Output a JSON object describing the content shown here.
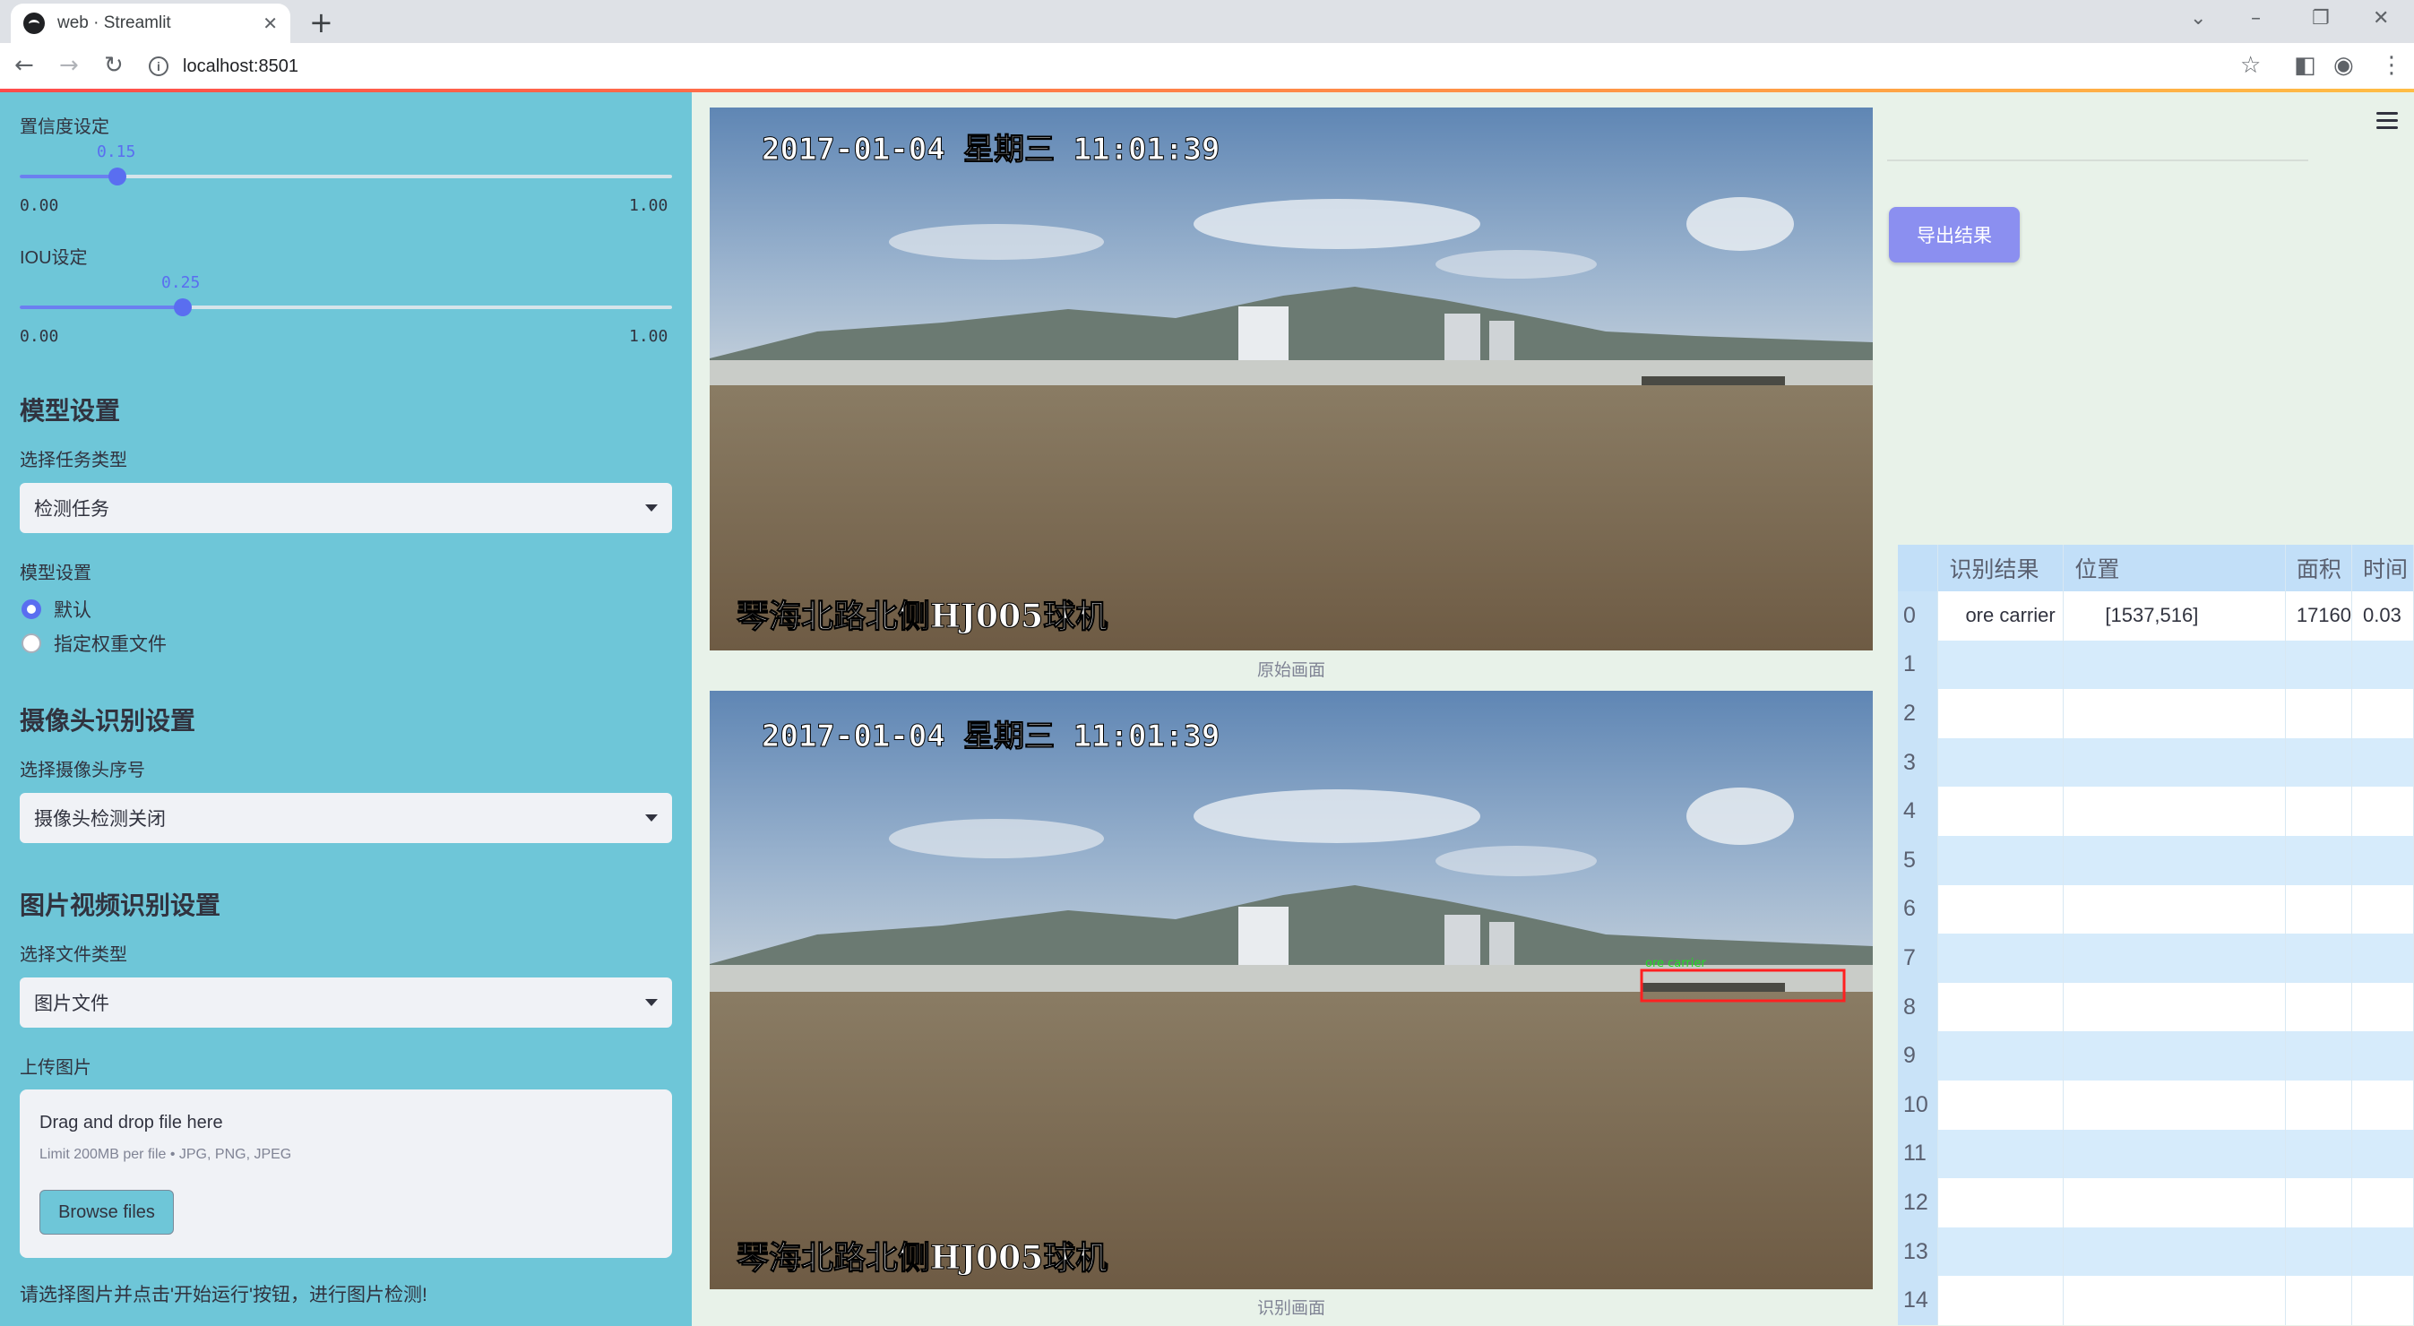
{
  "browser": {
    "tab_title": "web · Streamlit",
    "url": "localhost:8501"
  },
  "sidebar": {
    "confidence": {
      "label": "置信度设定",
      "value": "0.15",
      "min": "0.00",
      "max": "1.00",
      "fraction": 0.15
    },
    "iou": {
      "label": "IOU设定",
      "value": "0.25",
      "min": "0.00",
      "max": "1.00",
      "fraction": 0.25
    },
    "model_section": "模型设置",
    "task_label": "选择任务类型",
    "task_value": "检测任务",
    "model_label": "模型设置",
    "model_options": [
      "默认",
      "指定权重文件"
    ],
    "model_selected": "默认",
    "camera_section": "摄像头识别设置",
    "camera_label": "选择摄像头序号",
    "camera_value": "摄像头检测关闭",
    "media_section": "图片视频识别设置",
    "file_type_label": "选择文件类型",
    "file_type_value": "图片文件",
    "upload_label": "上传图片",
    "upload_title": "Drag and drop file here",
    "upload_limit": "Limit 200MB per file • JPG, PNG, JPEG",
    "browse_label": "Browse files",
    "hint": "请选择图片并点击'开始运行'按钮，进行图片检测!"
  },
  "main": {
    "frame_timestamp": "2017-01-04  星期三  11:01:39",
    "frame_overlay": "琴海北路北侧HJ005球机",
    "original_caption": "原始画面",
    "result_caption": "识别画面",
    "export_label": "导出结果",
    "detection_box_label": "ore carrier"
  },
  "table": {
    "columns": [
      "",
      "识别结果",
      "位置",
      "面积",
      "时间"
    ],
    "rows": [
      [
        "0",
        "ore carrier",
        "[1537,516]",
        "17160",
        "0.03"
      ],
      [
        "1",
        "",
        "",
        "",
        ""
      ],
      [
        "2",
        "",
        "",
        "",
        ""
      ],
      [
        "3",
        "",
        "",
        "",
        ""
      ],
      [
        "4",
        "",
        "",
        "",
        ""
      ],
      [
        "5",
        "",
        "",
        "",
        ""
      ],
      [
        "6",
        "",
        "",
        "",
        ""
      ],
      [
        "7",
        "",
        "",
        "",
        ""
      ],
      [
        "8",
        "",
        "",
        "",
        ""
      ],
      [
        "9",
        "",
        "",
        "",
        ""
      ],
      [
        "10",
        "",
        "",
        "",
        ""
      ],
      [
        "11",
        "",
        "",
        "",
        ""
      ],
      [
        "12",
        "",
        "",
        "",
        ""
      ],
      [
        "13",
        "",
        "",
        "",
        ""
      ],
      [
        "14",
        "",
        "",
        "",
        ""
      ]
    ]
  },
  "colors": {
    "sidebar_bg": "#6ec6d8",
    "main_bg": "#e8f2e9",
    "accent": "#5a6ef0",
    "detection_box": "#ff2020"
  }
}
